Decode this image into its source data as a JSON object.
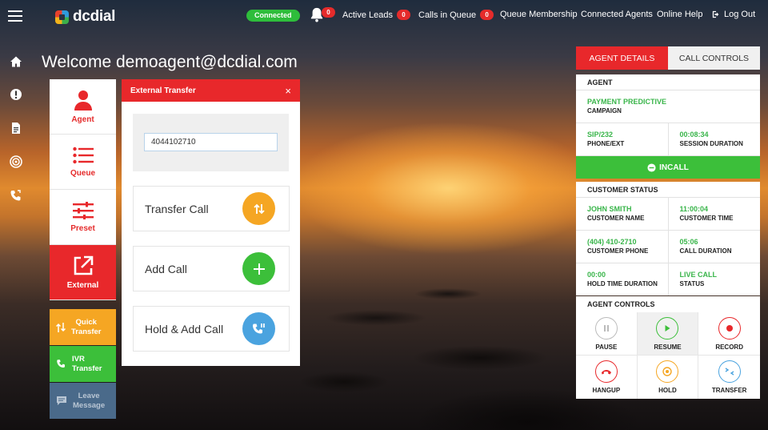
{
  "app": {
    "logo_text": "dcdial"
  },
  "topbar": {
    "connection_status": "Connected",
    "notifications_count": "0",
    "active_leads_label": "Active Leads",
    "active_leads_count": "0",
    "calls_in_queue_label": "Calls in Queue",
    "calls_in_queue_count": "0",
    "queue_membership": "Queue Membership",
    "connected_agents": "Connected Agents",
    "online_help": "Online Help",
    "logout": "Log Out"
  },
  "welcome": "Welcome demoagent@dcdial.com",
  "menu": [
    {
      "label": "Agent"
    },
    {
      "label": "Queue"
    },
    {
      "label": "Preset"
    },
    {
      "label": "External"
    }
  ],
  "submenu": [
    {
      "label": "Quick\nTransfer",
      "color": "#f5a623"
    },
    {
      "label": "IVR\nTransfer",
      "color": "#3cbf3a"
    },
    {
      "label": "Leave\nMessage",
      "color": "#4a6a8a"
    }
  ],
  "transfer_panel": {
    "title": "External Transfer",
    "close_symbol": "×",
    "number_value": "4044102710",
    "actions": [
      {
        "label": "Transfer Call",
        "color": "#f5a623"
      },
      {
        "label": "Add Call",
        "color": "#3cbf3a"
      },
      {
        "label": "Hold & Add Call",
        "color": "#4aa3df"
      }
    ]
  },
  "right_panel": {
    "tabs": [
      "AGENT DETAILS",
      "CALL CONTROLS"
    ],
    "agent": {
      "title": "AGENT",
      "campaign_value": "PAYMENT PREDICTIVE",
      "campaign_label": "CAMPAIGN",
      "phone_value": "SIP/232",
      "phone_label": "PHONE/EXT",
      "session_value": "00:08:34",
      "session_label": "SESSION DURATION",
      "status_button": "INCALL"
    },
    "customer": {
      "title": "CUSTOMER STATUS",
      "name_value": "JOHN SMITH",
      "name_label": "CUSTOMER NAME",
      "time_value": "11:00:04",
      "time_label": "CUSTOMER TIME",
      "phone_value": "(404) 410-2710",
      "phone_label": "CUSTOMER PHONE",
      "duration_value": "05:06",
      "duration_label": "CALL DURATION",
      "hold_value": "00:00",
      "hold_label": "HOLD TIME DURATION",
      "status_value": "LIVE CALL",
      "status_label": "STATUS"
    },
    "controls": {
      "title": "AGENT CONTROLS",
      "buttons": [
        {
          "label": "PAUSE",
          "color": "#bbbbbb"
        },
        {
          "label": "RESUME",
          "color": "#3cbf3a"
        },
        {
          "label": "RECORD",
          "color": "#e8282b"
        },
        {
          "label": "HANGUP",
          "color": "#e8282b"
        },
        {
          "label": "HOLD",
          "color": "#f5a623"
        },
        {
          "label": "TRANSFER",
          "color": "#4aa3df"
        }
      ]
    }
  }
}
